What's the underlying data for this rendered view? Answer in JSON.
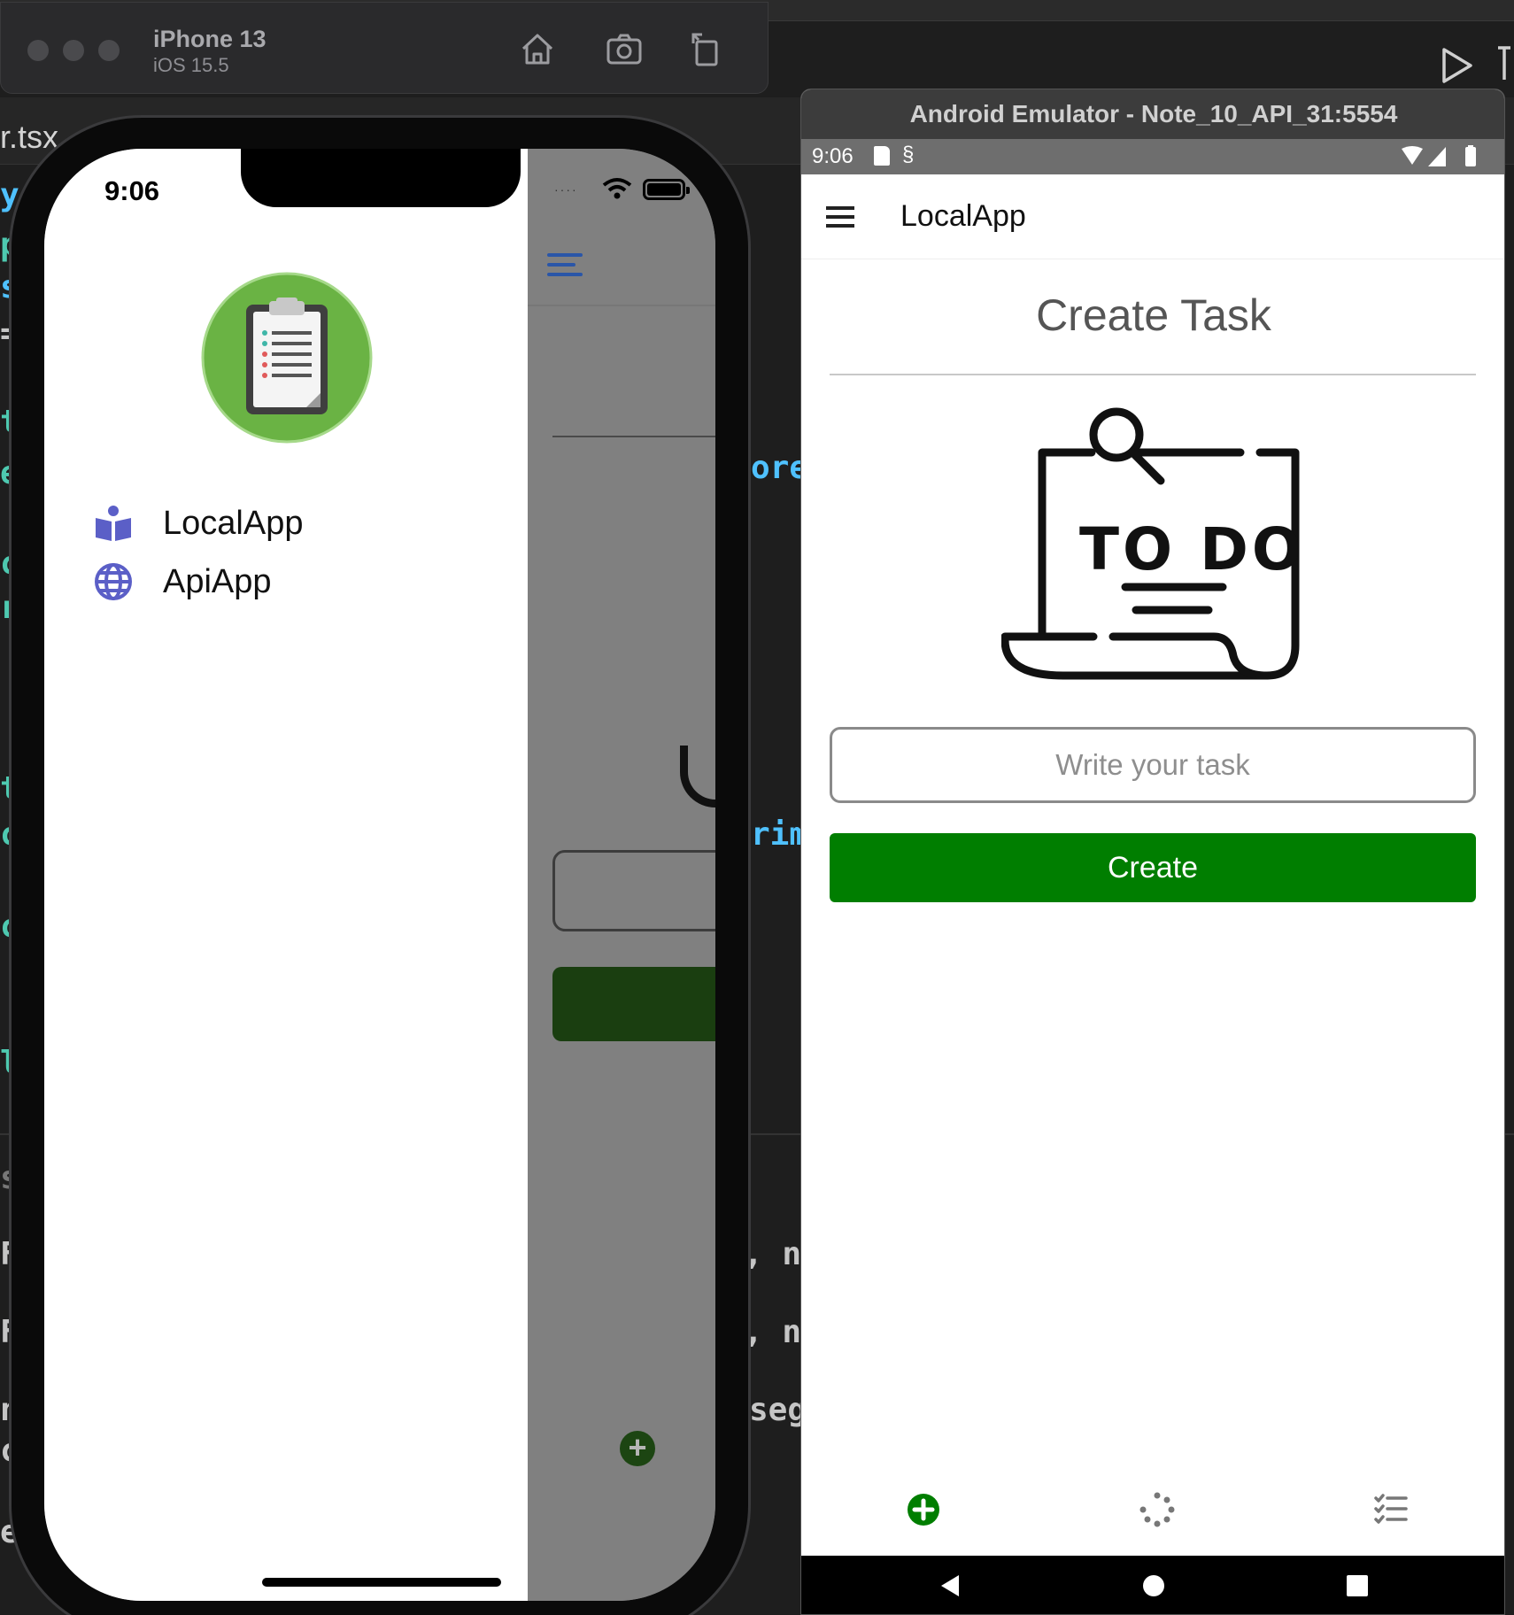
{
  "editor": {
    "tab_fragment": "r.tsx",
    "fragments": {
      "ore": "ore",
      "rim": "rim",
      "n1": ", n",
      "n2": ", n",
      "seg": "seg",
      "l1": "y",
      "l2": "p",
      "l3": "s",
      "l4": "=",
      "l5": "t",
      "l6": "e",
      "l7": "c",
      "l8": "r",
      "l9": "t",
      "l10": "c",
      "l11": "c",
      "l12": "l",
      "l13": "s",
      "l14": "F",
      "l15": "F",
      "l16": "n",
      "l17": "c",
      "l18": "e"
    }
  },
  "ios_simulator": {
    "device_name": "iPhone 13",
    "os_version": "iOS 15.5",
    "toolbar_icons": [
      "home-icon",
      "screenshot-icon",
      "rotate-icon"
    ],
    "status_time": "9:06",
    "drawer": {
      "items": [
        {
          "label": "LocalApp",
          "icon": "reader-icon",
          "color": "#5b5fc7"
        },
        {
          "label": "ApiApp",
          "icon": "globe-icon",
          "color": "#5b5fc7"
        }
      ]
    },
    "logo_color": "#6ab344"
  },
  "android_emulator": {
    "window_title": "Android Emulator - Note_10_API_31:5554",
    "status_time": "9:06",
    "app_bar_title": "LocalApp",
    "heading": "Create Task",
    "illustration_text": "TO DO",
    "input": {
      "placeholder": "Write your task",
      "value": ""
    },
    "create_button_label": "Create",
    "accent_color": "#007e00",
    "tabs": [
      "add-circle-icon",
      "loading-icon",
      "checklist-icon"
    ],
    "nav_buttons": [
      "back-icon",
      "home-icon",
      "overview-icon"
    ]
  }
}
